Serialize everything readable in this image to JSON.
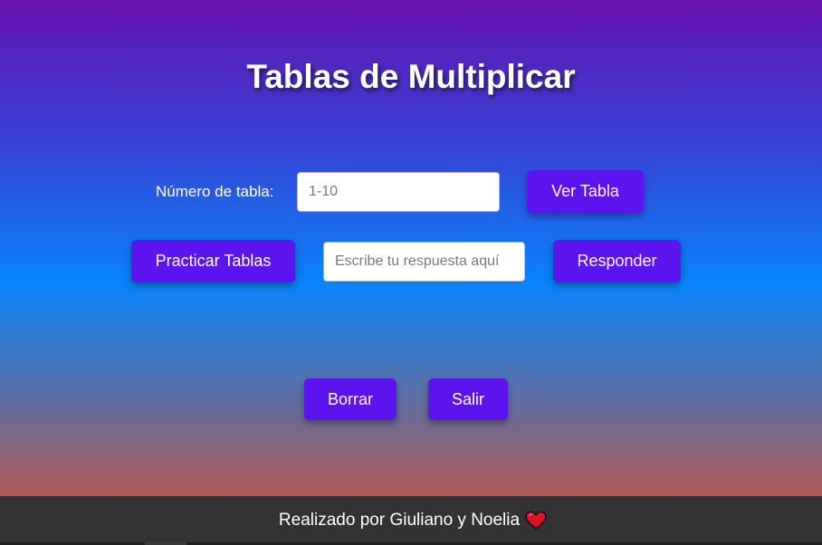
{
  "page": {
    "title": "Tablas de Multiplicar"
  },
  "table_row": {
    "label": "Número de tabla:",
    "input_placeholder": "1-10",
    "view_button": "Ver Tabla"
  },
  "practice_row": {
    "practice_button": "Practicar Tablas",
    "answer_placeholder": "Escribe tu respuesta aquí",
    "respond_button": "Responder"
  },
  "actions": {
    "clear_button": "Borrar",
    "exit_button": "Salir"
  },
  "footer": {
    "text": "Realizado por Giuliano y Noelia",
    "icon": "heart-icon"
  },
  "colors": {
    "button": "#5c14ee",
    "footer": "#333333",
    "gradient_top": "#6512b1",
    "gradient_mid": "#0984fb",
    "gradient_bottom": "#d54f2c"
  }
}
